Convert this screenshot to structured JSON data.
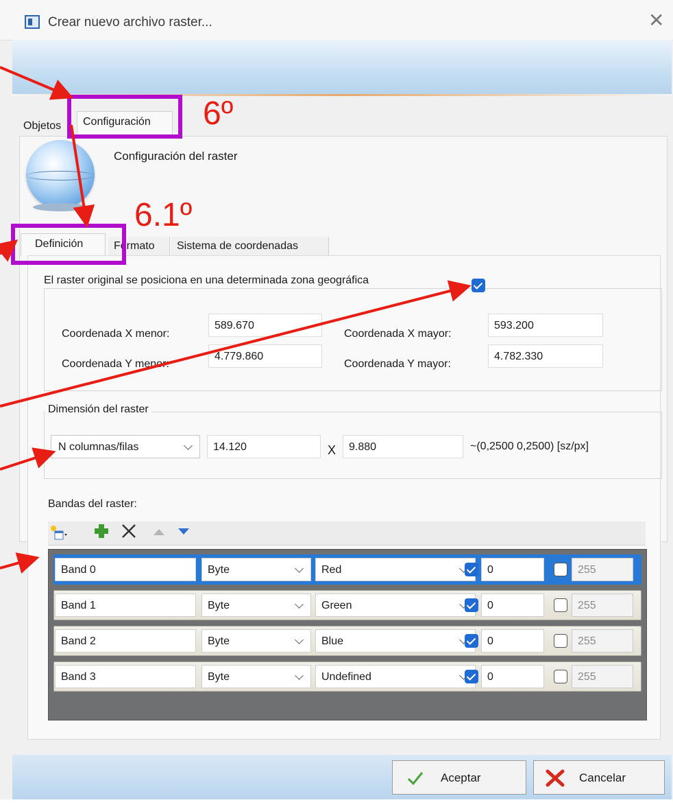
{
  "window": {
    "title": "Crear nuevo archivo raster...",
    "close_label": "✕"
  },
  "tabs_top": [
    {
      "label": "Objetos"
    },
    {
      "label": "Configuración"
    }
  ],
  "heading": "Configuración del raster",
  "tabs_inner": [
    {
      "label": "Definición"
    },
    {
      "label": "Formato"
    },
    {
      "label": "Sistema de coordenadas"
    }
  ],
  "geo": {
    "checkbox_label": "El raster original se posiciona en una determinada zona geográfica",
    "checked": true,
    "x_min_label": "Coordenada X menor:",
    "x_min": "589.670",
    "x_max_label": "Coordenada X mayor:",
    "x_max": "593.200",
    "y_min_label": "Coordenada Y menor:",
    "y_min": "4.779.860",
    "y_max_label": "Coordenada Y mayor:",
    "y_max": "4.782.330"
  },
  "dimension": {
    "group_label": "Dimensión del raster",
    "mode": "N columnas/filas",
    "columns": "14.120",
    "separator": "X",
    "rows": "9.880",
    "resolution_text": "~(0,2500 0,2500) [sz/px]"
  },
  "bands": {
    "label": "Bandas del raster:",
    "rows": [
      {
        "name": "Band 0",
        "type": "Byte",
        "color": "Red",
        "nodata_checked": true,
        "nodata": "0",
        "max_checked": false,
        "max": "255",
        "selected": true
      },
      {
        "name": "Band 1",
        "type": "Byte",
        "color": "Green",
        "nodata_checked": true,
        "nodata": "0",
        "max_checked": false,
        "max": "255",
        "selected": false
      },
      {
        "name": "Band 2",
        "type": "Byte",
        "color": "Blue",
        "nodata_checked": true,
        "nodata": "0",
        "max_checked": false,
        "max": "255",
        "selected": false
      },
      {
        "name": "Band 3",
        "type": "Byte",
        "color": "Undefined",
        "nodata_checked": true,
        "nodata": "0",
        "max_checked": false,
        "max": "255",
        "selected": false
      }
    ]
  },
  "buttons": {
    "accept": "Aceptar",
    "cancel": "Cancelar"
  },
  "annotations": {
    "step_6": "6º",
    "step_6_1": "6.1º"
  },
  "colors": {
    "annotation_box": "#b10dcc",
    "annotation_arrow": "#e81e14",
    "selection": "#2878d6",
    "checkbox_on": "#1f6ad3"
  }
}
